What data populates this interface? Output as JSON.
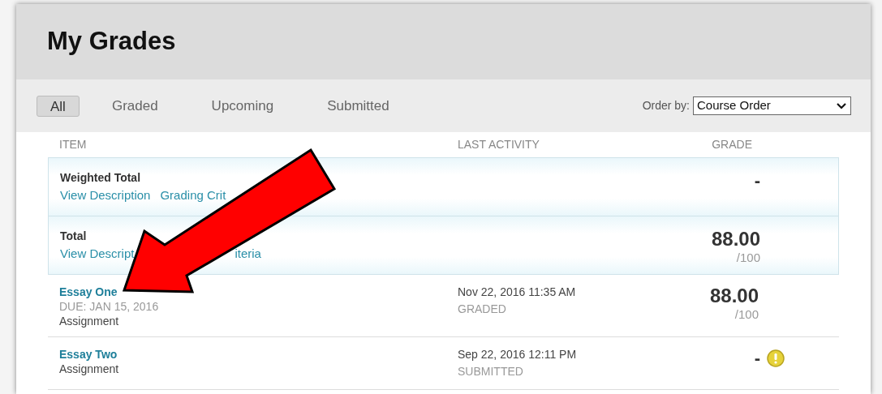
{
  "header": {
    "title": "My Grades"
  },
  "tabs": [
    {
      "label": "All",
      "selected": true
    },
    {
      "label": "Graded",
      "selected": false
    },
    {
      "label": "Upcoming",
      "selected": false
    },
    {
      "label": "Submitted",
      "selected": false
    }
  ],
  "order_by": {
    "label": "Order by:",
    "value": "Course Order"
  },
  "table": {
    "columns": [
      "ITEM",
      "LAST ACTIVITY",
      "GRADE"
    ],
    "rows": [
      {
        "kind": "total",
        "title": "Weighted Total",
        "links": [
          "View Description",
          "Grading Crit"
        ],
        "grade": "-"
      },
      {
        "kind": "total",
        "title": "Total",
        "links": [
          "View Descript",
          "iteria"
        ],
        "grade": "88.00",
        "out_of": "/100"
      },
      {
        "kind": "item",
        "title": "Essay One",
        "due": "DUE: JAN 15, 2016",
        "type": "Assignment",
        "activity": "Nov 22, 2016 11:35 AM",
        "status": "GRADED",
        "grade": "88.00",
        "out_of": "/100",
        "alert": false
      },
      {
        "kind": "item",
        "title": "Essay Two",
        "type": "Assignment",
        "activity": "Sep 22, 2016 12:11 PM",
        "status": "SUBMITTED",
        "grade": "-",
        "alert": true
      }
    ]
  },
  "annotation": {
    "kind": "arrow"
  }
}
